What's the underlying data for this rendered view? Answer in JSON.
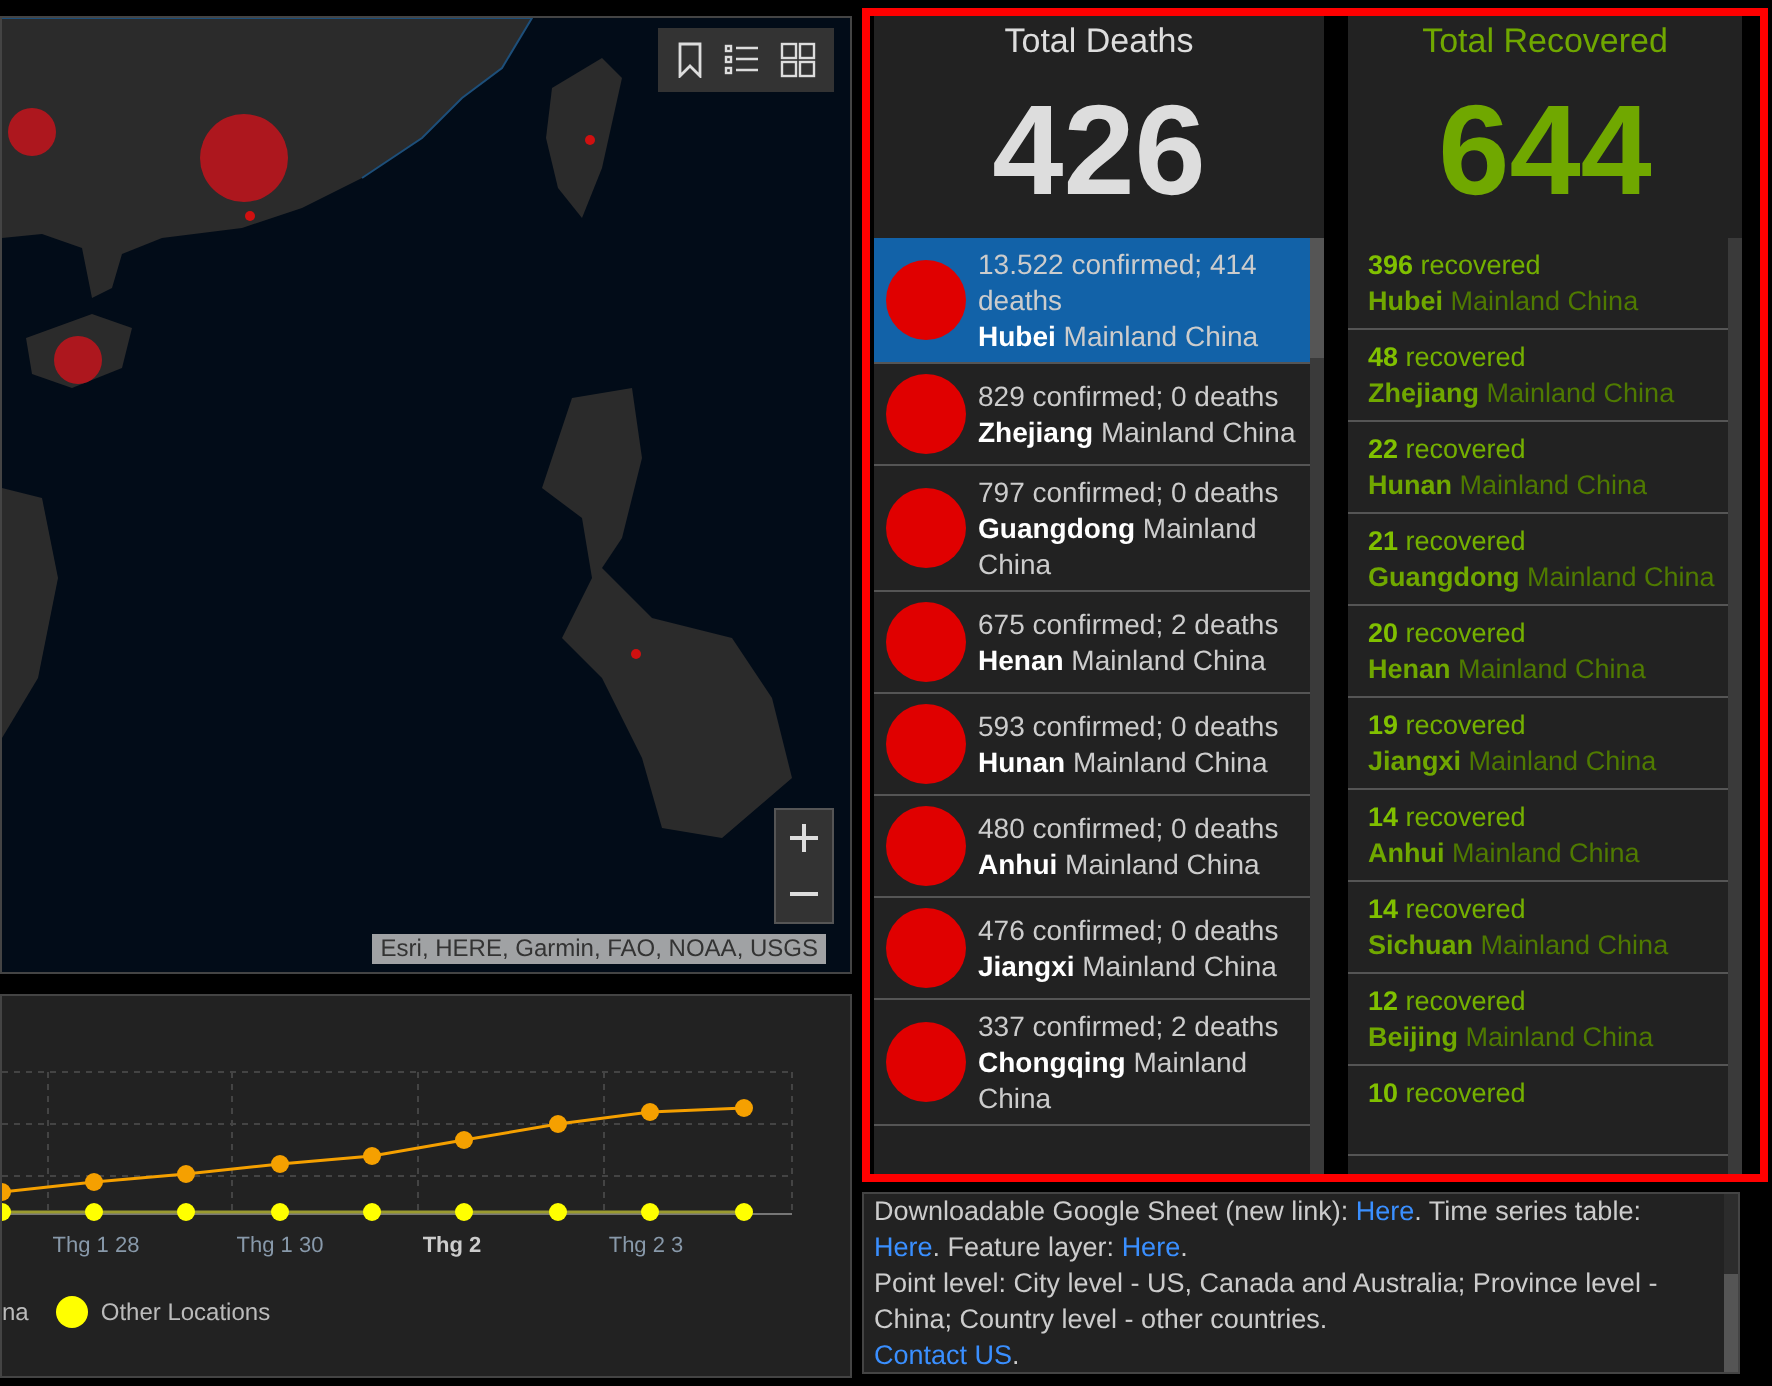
{
  "map": {
    "attribution": "Esri, HERE, Garmin, FAO, NOAA, USGS"
  },
  "chart": {
    "x_labels": [
      {
        "text": "Thg 1 28",
        "emphasized": false
      },
      {
        "text": "Thg 1 30",
        "emphasized": false
      },
      {
        "text": "Thg 2",
        "emphasized": true
      },
      {
        "text": "Thg 2 3",
        "emphasized": false
      }
    ],
    "legend": [
      {
        "label": "na"
      },
      {
        "label": "Other Locations",
        "color": "#ffff00"
      }
    ]
  },
  "deaths": {
    "title": "Total Deaths",
    "total": "426",
    "items": [
      {
        "stats": "13.522 confirmed; 414 deaths",
        "place": "**Hubei** Mainland China",
        "selected": true
      },
      {
        "stats": "829 confirmed; 0 deaths",
        "place": "**Zhejiang** Mainland China",
        "selected": false
      },
      {
        "stats": "797 confirmed; 0 deaths",
        "place": "**Guangdong** Mainland China",
        "selected": false
      },
      {
        "stats": "675 confirmed; 2 deaths",
        "place": "**Henan** Mainland China",
        "selected": false
      },
      {
        "stats": "593 confirmed; 0 deaths",
        "place": "**Hunan** Mainland China",
        "selected": false
      },
      {
        "stats": "480 confirmed; 0 deaths",
        "place": "**Anhui** Mainland China",
        "selected": false
      },
      {
        "stats": "476 confirmed; 0 deaths",
        "place": "**Jiangxi** Mainland China",
        "selected": false
      },
      {
        "stats": "337 confirmed; 2 deaths",
        "place": "**Chongqing** Mainland China",
        "selected": false
      }
    ]
  },
  "recovered": {
    "title": "Total Recovered",
    "total": "644",
    "items": [
      {
        "count": "**396** recovered",
        "place": "**Hubei** Mainland China"
      },
      {
        "count": "**48** recovered",
        "place": "**Zhejiang** Mainland China"
      },
      {
        "count": "**22** recovered",
        "place": "**Hunan** Mainland China"
      },
      {
        "count": "**21** recovered",
        "place": "**Guangdong** Mainland China"
      },
      {
        "count": "**20** recovered",
        "place": "**Henan** Mainland China"
      },
      {
        "count": "**19** recovered",
        "place": "**Jiangxi** Mainland China"
      },
      {
        "count": "**14** recovered",
        "place": "**Anhui** Mainland China"
      },
      {
        "count": "**14** recovered",
        "place": "**Sichuan** Mainland China"
      },
      {
        "count": "**12** recovered",
        "place": "**Beijing** Mainland China"
      },
      {
        "count": "**10** recovered"
      }
    ]
  },
  "info": {
    "paragraphs": [
      [
        {
          "kind": "text",
          "text": "Downloadable Google Sheet (new link): "
        },
        {
          "kind": "link",
          "text": "Here"
        },
        {
          "kind": "text",
          "text": ". Time series table: "
        },
        {
          "kind": "link",
          "text": "Here"
        },
        {
          "kind": "text",
          "text": ". Feature layer: "
        },
        {
          "kind": "link",
          "text": "Here"
        },
        {
          "kind": "text",
          "text": "."
        }
      ],
      [
        {
          "kind": "text",
          "text": "Point level: City level - US, Canada and Australia; Province level - China; Country level - other countries."
        }
      ],
      [
        {
          "kind": "link",
          "text": "Contact US"
        },
        {
          "kind": "text",
          "text": "."
        }
      ]
    ]
  }
}
